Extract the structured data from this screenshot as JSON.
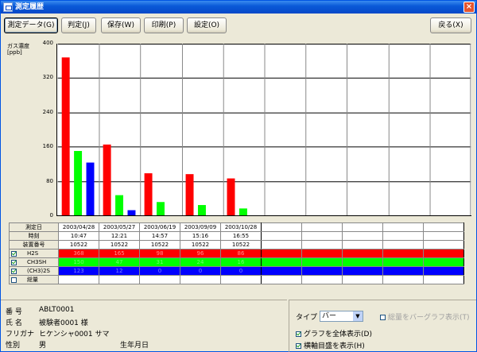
{
  "window": {
    "title": "測定履歴",
    "close_glyph": "×"
  },
  "toolbar": {
    "measure_data": "測定データ(G)",
    "judge": "判定(J)",
    "save": "保存(W)",
    "print": "印刷(P)",
    "settings": "設定(O)",
    "back": "戻る(X)"
  },
  "chart_data": {
    "type": "bar",
    "ylabel": "ガス濃度\n[ppb]",
    "ylim": [
      0,
      400
    ],
    "yticks": [
      "400",
      "320",
      "240",
      "160",
      "80",
      "0"
    ],
    "categories": [
      "2003/04/28",
      "2003/05/27",
      "2003/06/19",
      "2003/09/09",
      "2003/10/28"
    ],
    "slots": 10,
    "series": [
      {
        "name": "H2S",
        "color": "#FF0000",
        "values": [
          368,
          165,
          98,
          96,
          86
        ]
      },
      {
        "name": "CH3SH",
        "color": "#00FF00",
        "values": [
          150,
          47,
          31,
          24,
          16
        ]
      },
      {
        "name": "(CH3)2S",
        "color": "#0000FF",
        "values": [
          123,
          12,
          0,
          0,
          0
        ]
      }
    ]
  },
  "table": {
    "headers": {
      "date": "測定日",
      "time": "時刻",
      "device": "装置番号",
      "total": "総量"
    },
    "dates": [
      "2003/04/28",
      "2003/05/27",
      "2003/06/19",
      "2003/09/09",
      "2003/10/28",
      "",
      "",
      "",
      "",
      ""
    ],
    "times": [
      "10:47",
      "12:21",
      "14:57",
      "15:16",
      "16:55",
      "",
      "",
      "",
      "",
      ""
    ],
    "devices": [
      "10522",
      "10522",
      "10522",
      "10522",
      "10522",
      "",
      "",
      "",
      "",
      ""
    ],
    "rows": [
      {
        "label": "H2S",
        "color": "#FF0000",
        "values": [
          "368",
          "165",
          "98",
          "96",
          "86",
          "",
          "",
          "",
          "",
          ""
        ]
      },
      {
        "label": "CH3SH",
        "color": "#00FF00",
        "values": [
          "150",
          "47",
          "31",
          "24",
          "16",
          "",
          "",
          "",
          "",
          ""
        ]
      },
      {
        "label": "(CH3)2S",
        "color": "#0000FF",
        "values": [
          "123",
          "12",
          "0",
          "0",
          "0",
          "",
          "",
          "",
          "",
          ""
        ]
      }
    ]
  },
  "info": {
    "number_label": "番 号",
    "number_value": "ABLT0001",
    "name_label": "氏 名",
    "name_value": "被験者0001 様",
    "kana_label": "フリガナ",
    "kana_value": "ヒケンシャ0001 サマ",
    "sex_label": "性別",
    "sex_value": "男",
    "birth_label": "生年月日"
  },
  "options": {
    "type_label": "タイプ",
    "type_value": "バー",
    "total_bar": "総量をバーグラフ表示(T)",
    "show_all": "グラフを全体表示(D)",
    "show_grid": "横軸目盛を表示(H)"
  }
}
